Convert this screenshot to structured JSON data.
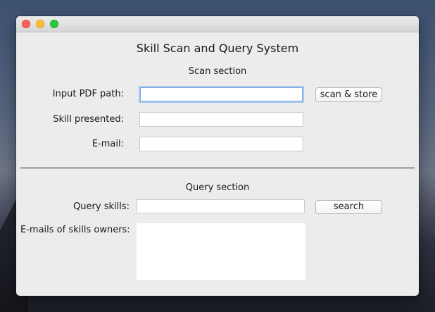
{
  "window": {
    "title": "Skill Scan and Query System"
  },
  "scan": {
    "section_label": "Scan section",
    "pdf_path_label": "Input PDF path:",
    "pdf_path_value": "",
    "scan_button": "scan & store",
    "skill_label": "Skill presented:",
    "skill_value": "",
    "email_label": "E-mail:",
    "email_value": ""
  },
  "query": {
    "section_label": "Query section",
    "skills_label": "Query skills:",
    "skills_value": "",
    "search_button": "search",
    "owners_label": "E-mails of skills owners:",
    "owners_value": ""
  }
}
